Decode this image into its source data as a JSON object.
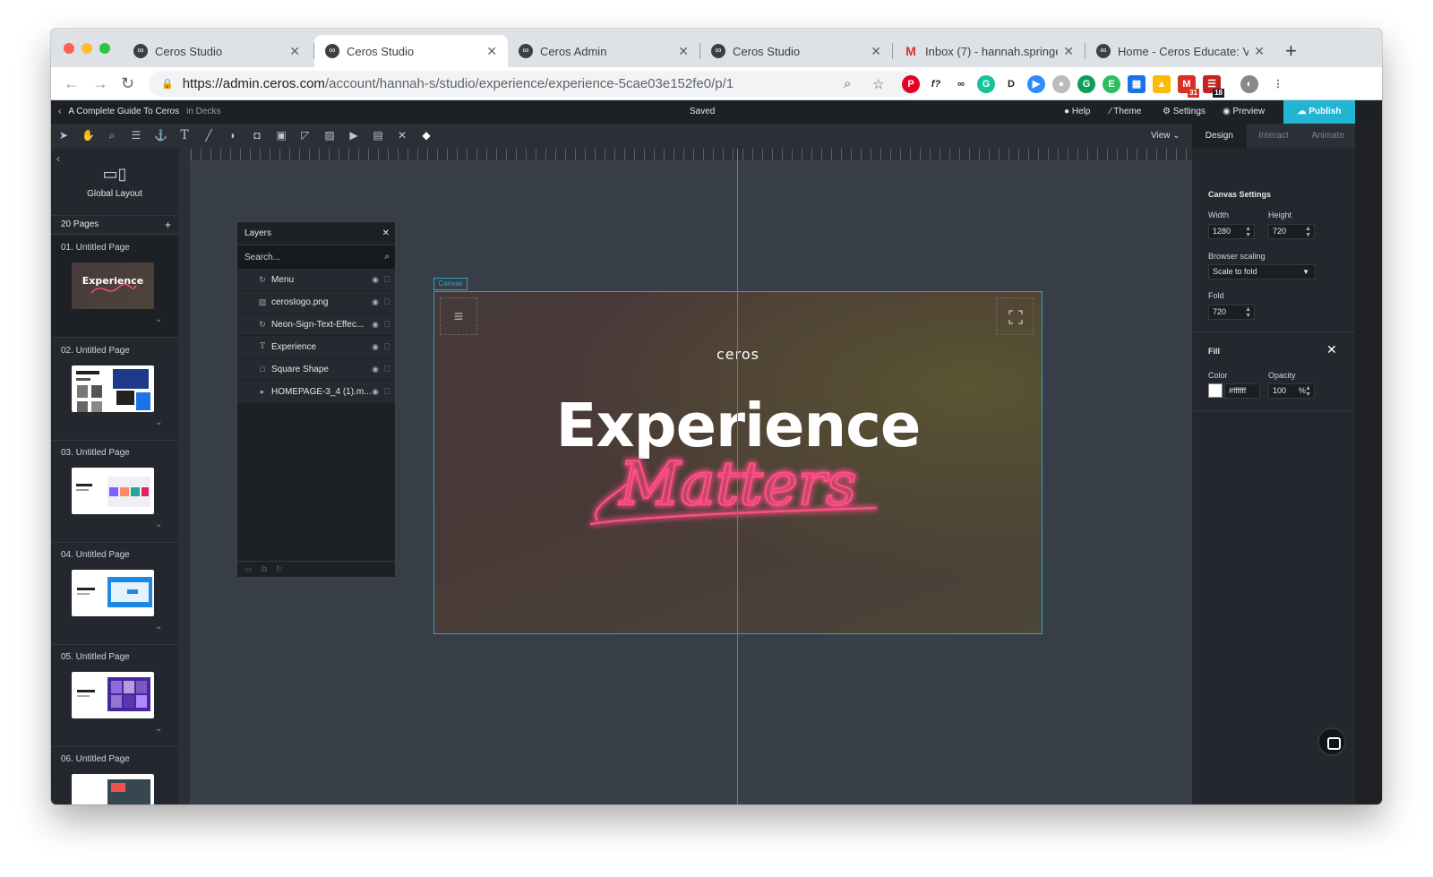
{
  "browser": {
    "tabs": [
      {
        "title": "Ceros Studio",
        "active": false
      },
      {
        "title": "Ceros Studio",
        "active": true
      },
      {
        "title": "Ceros Admin",
        "active": false
      },
      {
        "title": "Ceros Studio",
        "active": false
      },
      {
        "title": "Inbox (7) - hannah.springe",
        "active": false
      },
      {
        "title": "Home - Ceros Educate: Vi",
        "active": false
      }
    ],
    "url_host": "https://admin.ceros.com",
    "url_path": "/account/hannah-s/studio/experience/experience-5cae03e152fe0/p/1",
    "extension_badges": [
      "31",
      "18"
    ]
  },
  "header": {
    "doc_title": "A Complete Guide To Ceros",
    "location": "in Decks",
    "status": "Saved",
    "help": "Help",
    "theme": "Theme",
    "settings": "Settings",
    "preview": "Preview",
    "publish": "Publish"
  },
  "toolbar": {
    "view": "View"
  },
  "panel_tabs": [
    "Design",
    "Interact",
    "Animate"
  ],
  "sidebar": {
    "global_layout": "Global Layout",
    "page_count": "20 Pages",
    "pages": [
      {
        "label": "01. Untitled Page"
      },
      {
        "label": "02. Untitled Page"
      },
      {
        "label": "03. Untitled Page"
      },
      {
        "label": "04. Untitled Page"
      },
      {
        "label": "05. Untitled Page"
      },
      {
        "label": "06. Untitled Page"
      }
    ]
  },
  "layers": {
    "title": "Layers",
    "search_placeholder": "Search...",
    "items": [
      {
        "name": "Menu"
      },
      {
        "name": "cerosIogo.png"
      },
      {
        "name": "Neon-Sign-Text-Effec..."
      },
      {
        "name": "Experience"
      },
      {
        "name": "Square Shape"
      },
      {
        "name": "HOMEPAGE-3_4 (1).m..."
      }
    ]
  },
  "canvas": {
    "tag": "Canvas",
    "logo": "ceros",
    "headline": "Experience",
    "script": "Matters"
  },
  "design_panel": {
    "canvas_settings": "Canvas Settings",
    "width_label": "Width",
    "width": "1280",
    "height_label": "Height",
    "height": "720",
    "browser_scaling_label": "Browser scaling",
    "browser_scaling": "Scale to fold",
    "fold_label": "Fold",
    "fold": "720",
    "fill_title": "Fill",
    "color_label": "Color",
    "color_value": "#ffffff",
    "opacity_label": "Opacity",
    "opacity": "100",
    "opacity_unit": "%"
  },
  "colors": {
    "accent": "#22b4d3",
    "canvas_border": "#2fa4b8",
    "guide": "#b24cc6",
    "neon_pink": "#ff4d86"
  }
}
